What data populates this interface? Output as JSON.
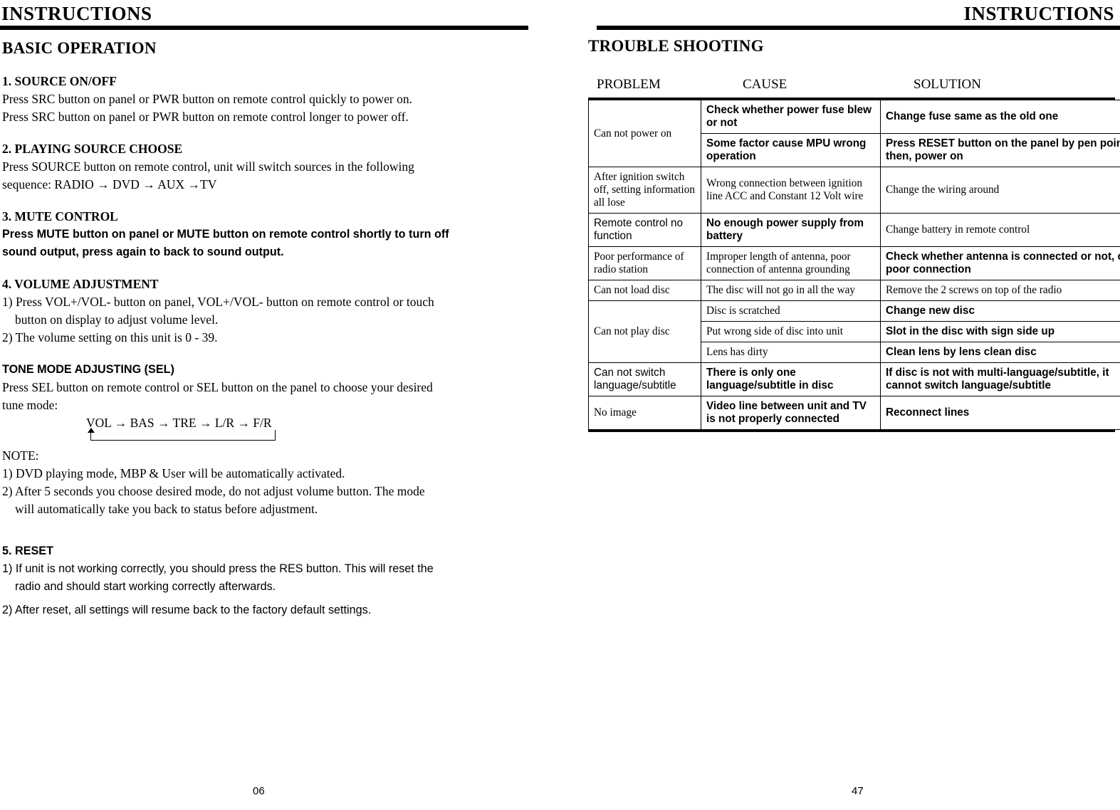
{
  "left_page": {
    "header": "INSTRUCTIONS",
    "section_title": "BASIC OPERATION",
    "page_number": "06",
    "blocks": [
      {
        "heading": "1. SOURCE ON/OFF",
        "lines": [
          "Press SRC button on panel or PWR button on remote control quickly to power on.",
          "Press SRC button on panel or PWR button on remote control longer to power off."
        ]
      },
      {
        "heading": "2. PLAYING SOURCE CHOOSE",
        "lines": [
          "Press SOURCE button on remote control, unit will switch sources in the following",
          "sequence: RADIO → DVD → AUX →TV"
        ]
      },
      {
        "heading": "3. MUTE CONTROL",
        "lines": [
          "Press MUTE button on panel or MUTE button on remote control shortly to turn off",
          "sound output, press again to back to sound output."
        ]
      },
      {
        "heading": "4. VOLUME ADJUSTMENT",
        "lines": [
          "1) Press VOL+/VOL- button on panel, VOL+/VOL- button on remote control or touch",
          "button on display to adjust volume level.",
          "2) The volume setting on this unit is 0 - 39."
        ]
      },
      {
        "heading": "TONE MODE ADJUSTING (SEL)",
        "lines": [
          "Press SEL button on remote control or SEL button on the panel to choose your desired",
          "tune mode:"
        ]
      }
    ],
    "tone_diagram": "VOL → BAS → TRE → L/R  → F/R",
    "note_label": "NOTE:",
    "note_lines": [
      "1) DVD playing mode, MBP & User will be automatically activated.",
      "2) After 5 seconds you choose desired mode, do not adjust volume button. The mode",
      "will automatically take you back to status before adjustment."
    ],
    "reset_heading": "5. RESET",
    "reset_lines": [
      "1) If unit is not working correctly, you should press the RES button. This will reset the",
      "radio and should start working correctly afterwards.",
      "2) After reset, all settings will resume back to the factory default settings."
    ]
  },
  "right_page": {
    "header": "INSTRUCTIONS",
    "section_title": "TROUBLE SHOOTING",
    "page_number": "47",
    "table_headers": [
      "PROBLEM",
      "CAUSE",
      "SOLUTION"
    ],
    "rows": [
      {
        "problem": "Can not power on",
        "problem_rowspan": 2,
        "cause": "Check whether power fuse blew or not",
        "solution": "Change fuse same as the old one"
      },
      {
        "cause": "Some factor cause MPU wrong operation",
        "solution": "Press RESET button on the panel by pen point, then, power on"
      },
      {
        "problem": "After ignition switch off, setting information all lose",
        "problem_rowspan": 1,
        "cause": "Wrong connection between ignition line ACC and Constant 12 Volt wire",
        "solution": "Change the wiring around"
      },
      {
        "problem": "Remote control no function",
        "problem_rowspan": 1,
        "cause": "No enough power supply from battery",
        "solution": "Change battery in remote control"
      },
      {
        "problem": "Poor performance of radio station",
        "problem_rowspan": 1,
        "cause": "Improper length of antenna, poor connection of antenna grounding",
        "solution": "Check whether antenna is connected or not, or poor connection"
      },
      {
        "problem": "Can not load disc",
        "problem_rowspan": 1,
        "cause": "The disc will not go in all the way",
        "solution": "Remove the 2 screws on top of the radio"
      },
      {
        "problem": "Can not play disc",
        "problem_rowspan": 3,
        "cause": "Disc is scratched",
        "solution": "Change new disc"
      },
      {
        "cause": "Put wrong side of disc into unit",
        "solution": "Slot in the disc with sign side up"
      },
      {
        "cause": "Lens has dirty",
        "solution": "Clean lens by lens clean disc"
      },
      {
        "problem": "Can not switch language/subtitle",
        "problem_rowspan": 1,
        "cause": "There is only one language/subtitle in disc",
        "solution": "If disc is not with multi-language/subtitle, it cannot switch language/subtitle"
      },
      {
        "problem": "No image",
        "problem_rowspan": 1,
        "cause": "Video line between unit and TV is not properly connected",
        "solution": "Reconnect lines"
      }
    ]
  }
}
